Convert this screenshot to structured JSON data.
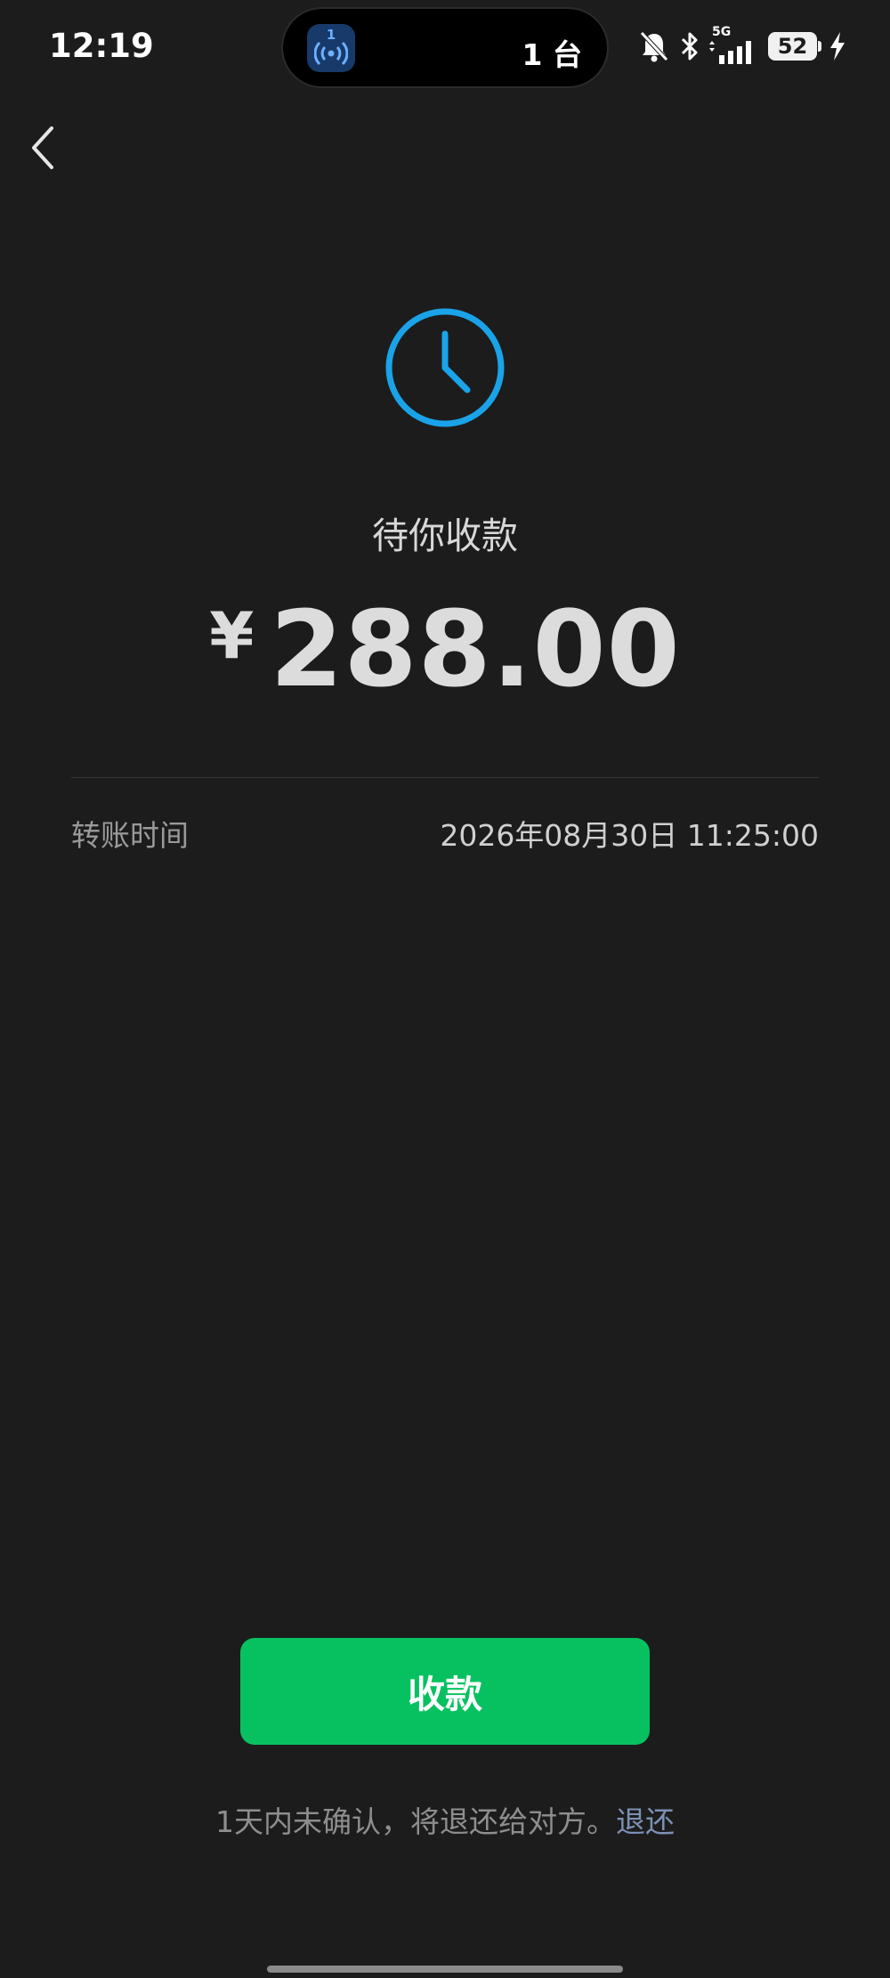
{
  "status_bar": {
    "time": "12:19",
    "island_badge": "1",
    "island_text": "1 台",
    "network": "5G",
    "battery_level": "52",
    "icons": [
      "bell-off-icon",
      "bluetooth-icon",
      "signal-icon",
      "battery-icon",
      "charging-icon"
    ]
  },
  "nav": {
    "back_icon": "chevron-left-icon"
  },
  "payment": {
    "status_icon": "clock-icon",
    "status_text": "待你收款",
    "currency": "¥",
    "amount": "288.00",
    "details": [
      {
        "label": "转账时间",
        "value": "2026年08月30日 11:25:00"
      }
    ]
  },
  "actions": {
    "receive_label": "收款",
    "notice_text": "1天内未确认，将退还给对方。",
    "refund_link": "退还"
  },
  "colors": {
    "background": "#1c1c1c",
    "accent_green": "#07c160",
    "clock_blue": "#1aa3e8",
    "link": "#7d90b6"
  }
}
